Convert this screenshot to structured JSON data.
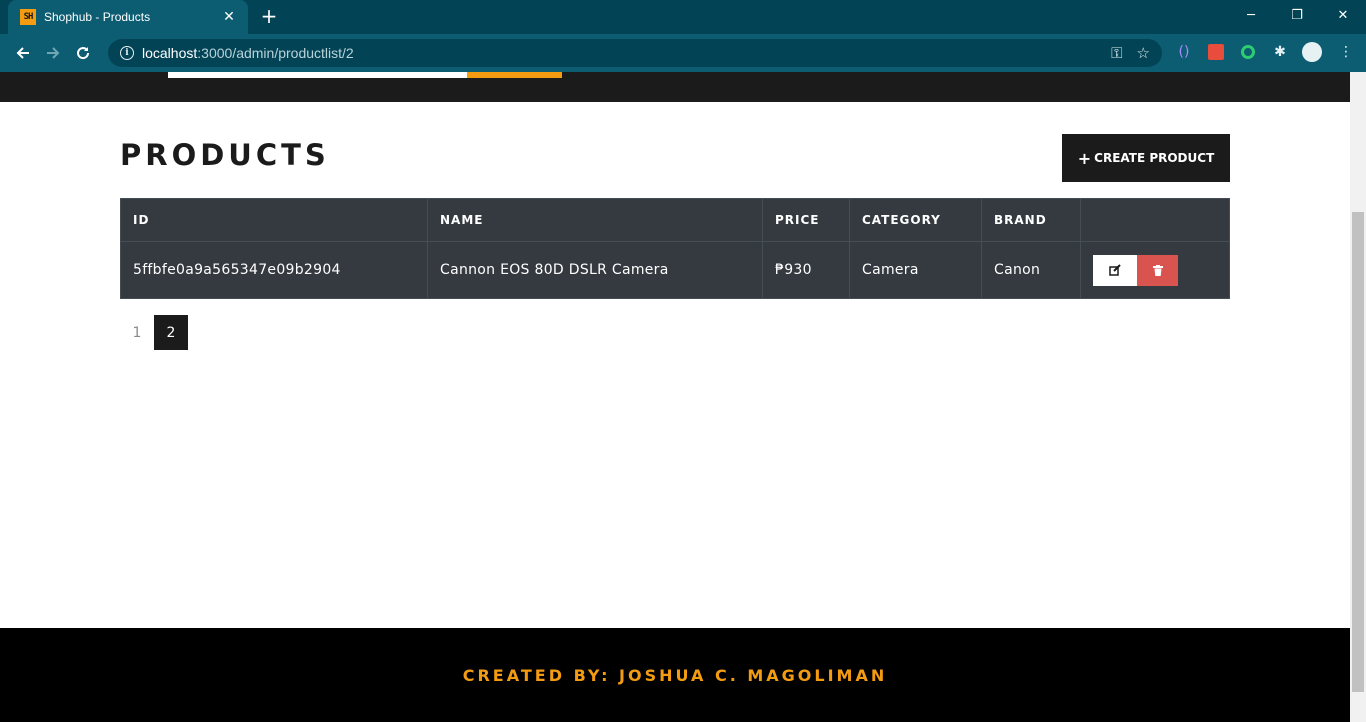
{
  "browser": {
    "tab_title": "Shophub - Products",
    "favicon_text": "SH",
    "url_host": "localhost",
    "url_rest": ":3000/admin/productlist/2"
  },
  "colors": {
    "brand": "#1b1b1b",
    "accent": "#f39c12",
    "table_bg": "#343a40",
    "danger": "#d9534f",
    "chrome": "#0c5d72"
  },
  "icons": {
    "create": "plus-icon",
    "edit": "edit-icon",
    "delete": "trash-icon"
  },
  "main": {
    "title": "PRODUCTS",
    "create_button": "CREATE PRODUCT"
  },
  "table": {
    "columns": [
      "ID",
      "NAME",
      "PRICE",
      "CATEGORY",
      "BRAND",
      ""
    ],
    "rows": [
      {
        "id": "5ffbfe0a9a565347e09b2904",
        "name": "Cannon EOS 80D DSLR Camera",
        "price": "₱930",
        "category": "Camera",
        "brand": "Canon"
      }
    ]
  },
  "pagination": {
    "pages": [
      "1",
      "2"
    ],
    "active": "2"
  },
  "footer": {
    "text": "CREATED BY: JOSHUA C. MAGOLIMAN"
  }
}
